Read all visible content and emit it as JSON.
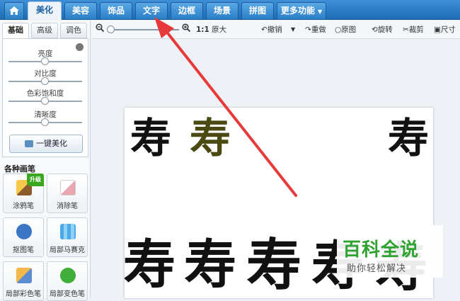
{
  "top_tabs": [
    "美化",
    "美容",
    "饰品",
    "文字",
    "边框",
    "场景",
    "拼图",
    "更多功能"
  ],
  "left_panel": {
    "subtabs": [
      "基础",
      "高级",
      "调色"
    ],
    "sliders": [
      {
        "label": "亮度",
        "value": 0.5
      },
      {
        "label": "对比度",
        "value": 0.5
      },
      {
        "label": "色彩饱和度",
        "value": 0.5
      },
      {
        "label": "清晰度",
        "value": 0.5
      }
    ],
    "onekey_label": "一键美化",
    "brush_section_title": "各种画笔",
    "brushes": [
      {
        "label": "涂鸦笔",
        "badge": "升级"
      },
      {
        "label": "消除笔"
      },
      {
        "label": "抠图笔"
      },
      {
        "label": "局部马赛克"
      },
      {
        "label": "局部彩色笔"
      },
      {
        "label": "局部变色笔"
      }
    ]
  },
  "toolbar": {
    "zoom_ratio": "1:1",
    "zoom_text": "原大",
    "undo": "撤销",
    "redo": "重做",
    "original": "原图",
    "rotate": "旋转",
    "crop": "裁剪",
    "size": "尺寸"
  },
  "canvas": {
    "callig_chars": [
      "寿",
      "寿",
      "寿",
      "寿",
      "寿",
      "寿",
      "寿",
      "寿"
    ]
  },
  "watermark": {
    "main": "百科全说",
    "sub": "助你轻松解决"
  },
  "colors": {
    "arrow": "#e83a3a",
    "tab_bar": "#2b7fc7",
    "watermark_green": "#2fa32f"
  }
}
